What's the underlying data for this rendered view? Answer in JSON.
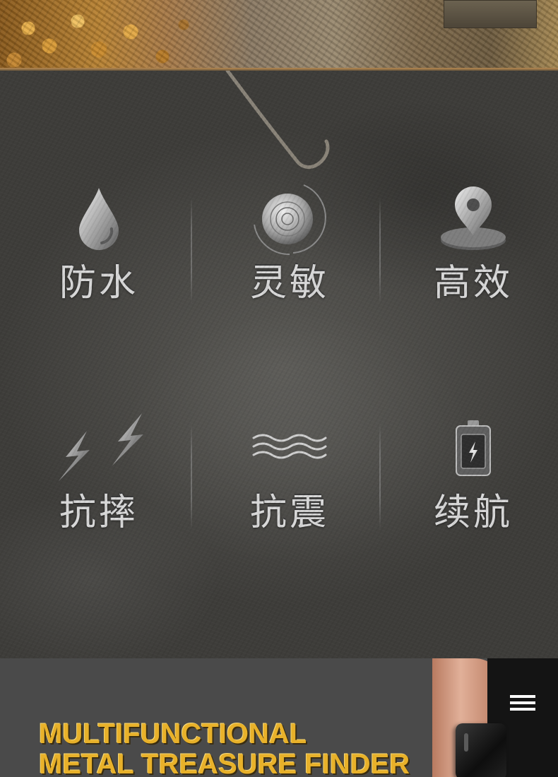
{
  "features": [
    {
      "label": "防水",
      "icon": "water-drop-icon"
    },
    {
      "label": "灵敏",
      "icon": "radar-icon"
    },
    {
      "label": "高效",
      "icon": "location-pin-icon"
    },
    {
      "label": "抗摔",
      "icon": "lightning-icon"
    },
    {
      "label": "抗震",
      "icon": "wave-icon"
    },
    {
      "label": "续航",
      "icon": "battery-icon"
    }
  ],
  "product": {
    "title_line1": "MULTIFUNCTIONAL",
    "title_line2": "METAL TREASURE FINDER",
    "menu_icon": "hamburger-menu-icon",
    "title_color": "#e8b12a"
  }
}
